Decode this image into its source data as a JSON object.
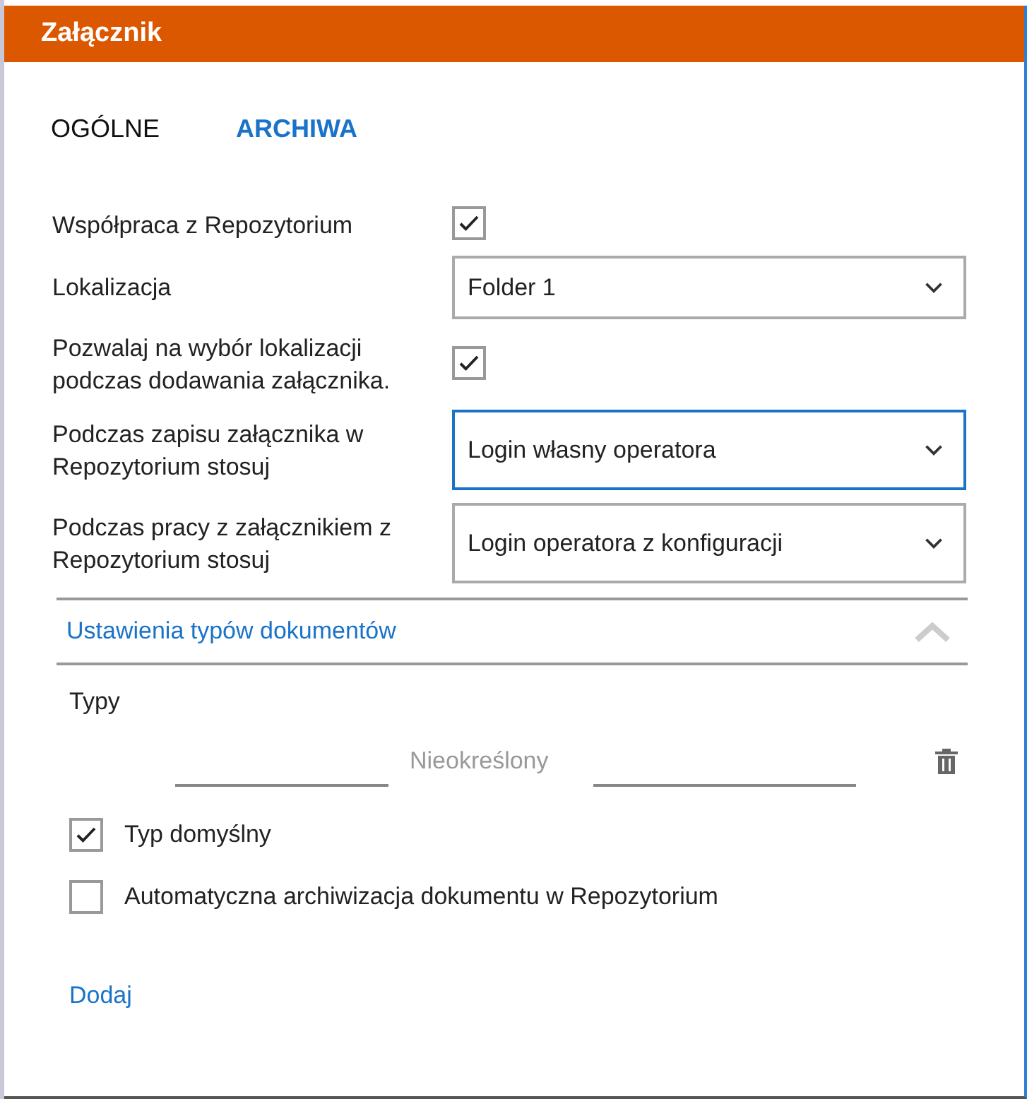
{
  "window": {
    "title": "Załącznik"
  },
  "tabs": [
    {
      "label": "OGÓLNE",
      "selected": false
    },
    {
      "label": "ARCHIWA",
      "selected": true
    }
  ],
  "fields": [
    {
      "kind": "checkbox",
      "label": "Współpraca z Repozytorium",
      "checked": true
    },
    {
      "kind": "select",
      "label": "Lokalizacja",
      "value": "Folder 1",
      "focused": false
    },
    {
      "kind": "checkbox",
      "label": "Pozwalaj na wybór lokalizacji podczas dodawania załącznika.",
      "checked": true
    },
    {
      "kind": "select",
      "label": "Podczas zapisu załącznika w Repozytorium stosuj",
      "value": "Login własny operatora",
      "focused": true
    },
    {
      "kind": "select",
      "label": "Podczas pracy z załącznikiem z Repozytorium stosuj",
      "value": "Login operatora z konfiguracji",
      "focused": false
    }
  ],
  "section": {
    "title": "Ustawienia typów dokumentów",
    "expanded": true,
    "types_label": "Typy",
    "type_placeholder": "Nieokreślony",
    "options": [
      {
        "label": "Typ domyślny",
        "checked": true
      },
      {
        "label": "Automatyczna archiwizacja dokumentu w Repozytorium",
        "checked": false
      }
    ],
    "add_link": "Dodaj"
  }
}
